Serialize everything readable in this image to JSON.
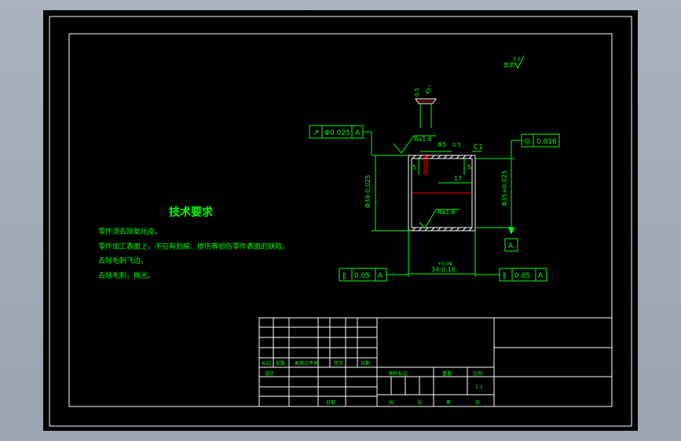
{
  "surface_finish_top": "3.2",
  "surface_finish_label": "其余",
  "top_detail": {
    "chamfer_value": "0.5",
    "angle_value": "45°"
  },
  "frames": {
    "runout_left": {
      "symbol": "↗",
      "value": "Φ0.025",
      "datum": "A"
    },
    "runout_right": {
      "symbol": "◎",
      "value": "0.016"
    },
    "parallel_left": {
      "symbol": "∥",
      "value": "0.05",
      "datum": "A"
    },
    "parallel_right": {
      "symbol": "∥",
      "value": "0.05",
      "datum": "A"
    }
  },
  "dimensions": {
    "ra_top": "Ra1.6",
    "ra_inner": "Ra1.6",
    "dia_5": "Φ5",
    "c1": "C1",
    "half_mm": "0.5",
    "five_left": "5",
    "five_right": "5",
    "seventeen": "17",
    "outer_dia": "Φ39-0.025",
    "inner_dia": "Φ35+0.025",
    "length_main": "34-0.16",
    "length_tol_upper": "+0.08",
    "datum_a": "A"
  },
  "tech_requirements": {
    "title": "技术要求",
    "items": [
      "零件须去除氧化皮。",
      "零件加工表面上，不应有划痕、擦伤等损伤零件表面的缺陷。",
      "去除毛刺飞边。",
      "去除毛刺，抛光。"
    ]
  },
  "title_block": {
    "row_labels": [
      "标记",
      "处数",
      "更改文件名",
      "签字",
      "日期"
    ],
    "design": "设计",
    "date_label": "日期",
    "stage_headers": [
      "图样标记",
      "重量",
      "比例"
    ],
    "scale": "1:1",
    "sheets_total": "共",
    "sheets_unit": "张",
    "sheet_no": "第",
    "sheet_unit2": "张"
  }
}
